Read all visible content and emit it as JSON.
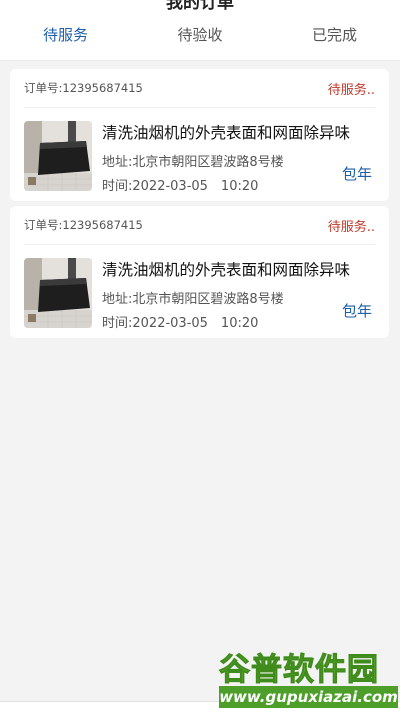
{
  "header": {
    "title": "我的订单"
  },
  "tabs": [
    {
      "label": "待服务",
      "active": true
    },
    {
      "label": "待验收",
      "active": false
    },
    {
      "label": "已完成",
      "active": false
    }
  ],
  "orders": [
    {
      "order_no": "订单号:12395687415",
      "status": "待服务..",
      "service_name": "清洗油烟机的外壳表面和网面除异味",
      "address": "地址:北京市朝阳区碧波路8号楼",
      "time": "时间:2022-03-05　10:20",
      "plan": "包年",
      "thumb_icon": "range-hood-photo"
    },
    {
      "order_no": "订单号:12395687415",
      "status": "待服务..",
      "service_name": "清洗油烟机的外壳表面和网面除异味",
      "address": "地址:北京市朝阳区碧波路8号楼",
      "time": "时间:2022-03-05　10:20",
      "plan": "包年",
      "thumb_icon": "range-hood-photo"
    }
  ],
  "watermark": {
    "name": "谷普软件园",
    "url": "www.gupuxiazai.com"
  },
  "colors": {
    "accent": "#1d5fa8",
    "status": "#c0392b",
    "background": "#f3f3f3"
  }
}
